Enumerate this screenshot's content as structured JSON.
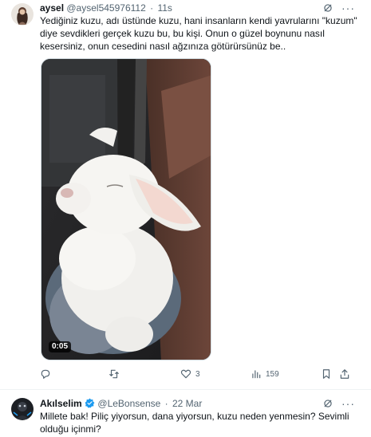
{
  "tweet1": {
    "display_name": "aysel",
    "handle": "@aysel545976112",
    "separator": "·",
    "time": "11s",
    "text_lines": [
      "Yediğiniz kuzu, adı üstünde kuzu, hani insanların kendi yavrularını \"kuzum\"",
      "diye sevdikleri gerçek kuzu bu, bu kişi. Onun o güzel boynunu nasıl",
      "kesersiniz, onun cesedini nasıl ağzınıza götürürsünüz be.."
    ],
    "video_duration": "0:05",
    "actions": {
      "reply_count": "",
      "retweet_count": "",
      "like_count": "3",
      "views_count": "159"
    }
  },
  "tweet2": {
    "display_name": "Akılselim",
    "handle": "@LeBonsense",
    "separator": "·",
    "time": "22 Mar",
    "text_lines": [
      "Millete bak! Piliç yiyorsun, dana yiyorsun, kuzu neden yenmesin? Sevimli",
      "olduğu içinmi?"
    ]
  },
  "colors": {
    "text_primary": "#0f1419",
    "text_secondary": "#536471",
    "verified_blue": "#1d9bf0",
    "border": "#eff3f4"
  }
}
